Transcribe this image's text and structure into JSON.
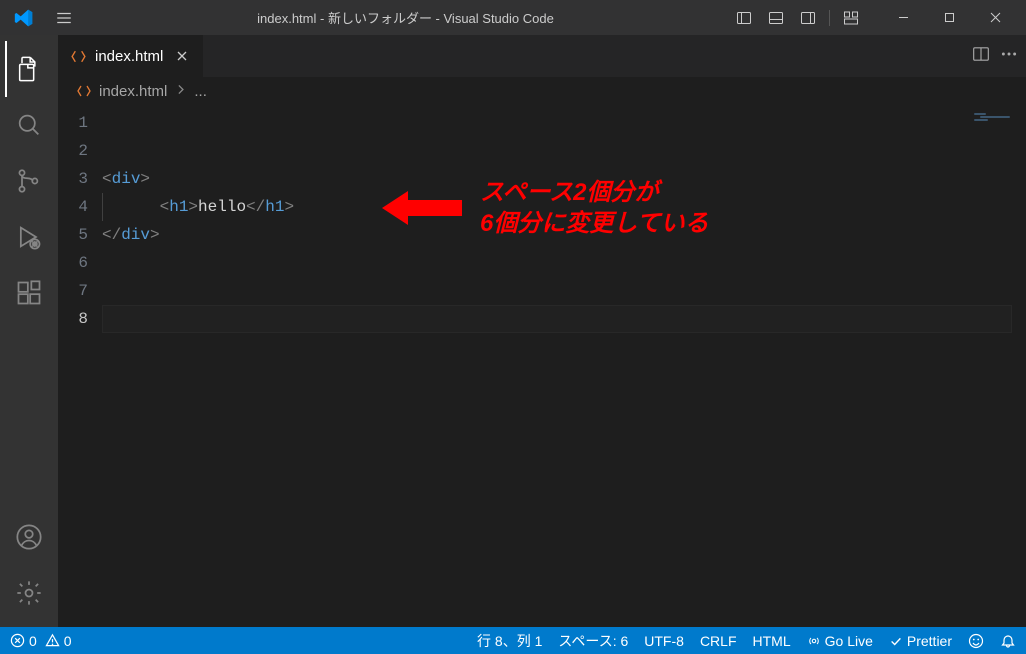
{
  "titlebar": {
    "title": "index.html - 新しいフォルダー - Visual Studio Code"
  },
  "tab": {
    "label": "index.html"
  },
  "breadcrumbs": {
    "file": "index.html",
    "ellipsis": "..."
  },
  "editor": {
    "line_numbers": [
      "1",
      "2",
      "3",
      "4",
      "5",
      "6",
      "7",
      "8"
    ],
    "current_line": 8,
    "lines": [
      {
        "type": "blank"
      },
      {
        "type": "blank"
      },
      {
        "type": "open",
        "indent": 0,
        "tag": "div"
      },
      {
        "type": "h1",
        "indent": 3,
        "tag": "h1",
        "text": "hello"
      },
      {
        "type": "close",
        "indent": 0,
        "tag": "div"
      },
      {
        "type": "blank"
      },
      {
        "type": "blank"
      },
      {
        "type": "blank"
      }
    ]
  },
  "annotation": {
    "line1": "スペース2個分が",
    "line2": "6個分に変更している"
  },
  "statusbar": {
    "errors": "0",
    "warnings": "0",
    "cursor": "行 8、列 1",
    "spaces": "スペース: 6",
    "encoding": "UTF-8",
    "eol": "CRLF",
    "language": "HTML",
    "golive": "Go Live",
    "prettier": "Prettier"
  }
}
